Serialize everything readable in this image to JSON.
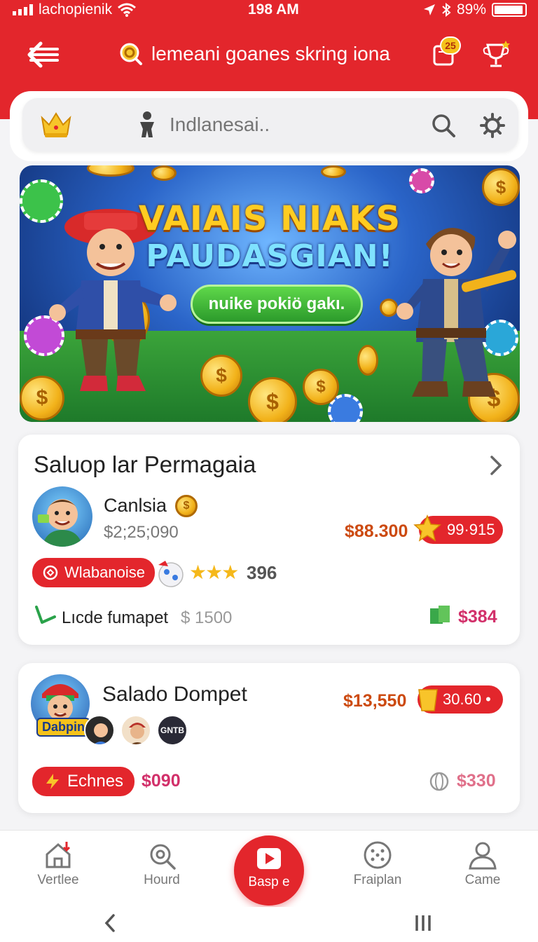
{
  "status": {
    "carrier": "lachopienik",
    "time": "198 AM",
    "battery": "89%"
  },
  "header": {
    "title": "lemeani goanes skring iona",
    "badge": "25"
  },
  "search": {
    "placeholder": "Indlanesai.."
  },
  "banner": {
    "line1": "VAIAIS NIAKS",
    "line2": "PAUDASGIAN!",
    "cta": "nuike pokiö gakı."
  },
  "card1": {
    "title": "Saluop lar Permagaia",
    "player": {
      "name": "Canlsia",
      "amount": "$2;25;090",
      "price": "$88.300",
      "tag": "99·915"
    },
    "pill": "Wlabanoise",
    "stars": "396",
    "footer": {
      "label": "Lıcde fumapet",
      "value": "$ 1500",
      "right": "$384"
    }
  },
  "card2": {
    "title": "Salado Dompet",
    "avatar_label": "Dabpin",
    "mini_badge": "GNTB",
    "price": "$13,550",
    "tag": "30.60 •",
    "pill": "Echnes",
    "pill_value": "$090",
    "right": "$330"
  },
  "nav": {
    "items": [
      {
        "label": "Vertlee"
      },
      {
        "label": "Hourd"
      },
      {
        "label": "Basp e"
      },
      {
        "label": "Fraiplan"
      },
      {
        "label": "Came"
      }
    ]
  },
  "colors": {
    "accent": "#e3262c",
    "gold": "#f2b21a",
    "price": "#cc4a10"
  }
}
